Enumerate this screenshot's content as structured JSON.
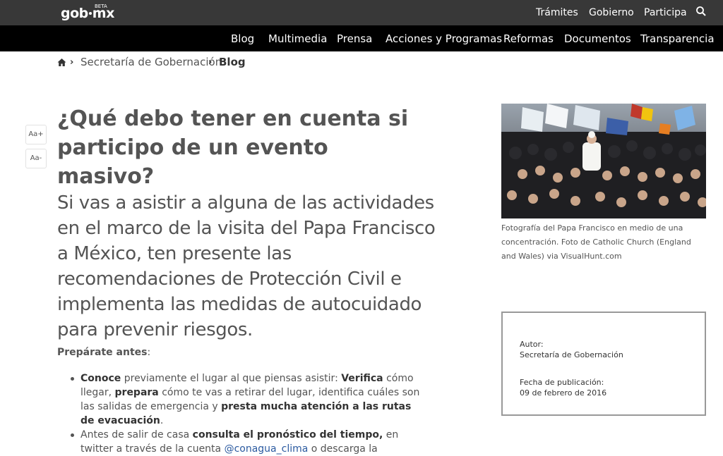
{
  "header": {
    "logo_prefix": "gob",
    "logo_suffix": "mx",
    "beta": "BETA",
    "top_links": [
      "Trámites",
      "Gobierno",
      "Participa"
    ],
    "search_icon": "search-icon"
  },
  "mainnav": {
    "items": [
      "Blog",
      "Multimedia",
      "Prensa",
      "Acciones y Programas",
      "Reformas",
      "Documentos",
      "Transparencia"
    ]
  },
  "breadcrumb": {
    "home_icon": "home-icon",
    "link": "Secretaría de Gobernación",
    "current": "Blog"
  },
  "font_controls": {
    "increase": "Aa+",
    "decrease": "Aa-"
  },
  "article": {
    "title": "¿Qué debo tener en cuenta si participo de un evento masivo?",
    "lead": "Si vas a asistir a alguna de las actividades en el marco de la visita del Papa Francisco a México, ten presente las recomendaciones de Protección Civil e implementa las medidas de autocuidado para prevenir riesgos.",
    "prep_bold": "Prepárate antes",
    "prep_colon": ":",
    "bullet1": {
      "b1": "Conoce",
      "t1": " previamente el lugar al que piensas asistir: ",
      "b2": "Verifica",
      "t2": " cómo llegar, ",
      "b3": "prepara",
      "t3": " cómo te vas a retirar del lugar, identifica cuáles son las salidas de emergencia y ",
      "b4": "presta mucha atención a las rutas de evacuación",
      "t4": "."
    },
    "bullet2": {
      "t1": "Antes de salir de casa ",
      "b1": "consulta el pronóstico del tiempo,",
      "t2": " en twitter a través de la cuenta ",
      "link": "@conagua_clima",
      "t3": " o descarga la aplicación MeteoInfo disponible para dispositivos iOS y Android."
    }
  },
  "sidebar": {
    "caption": "Fotografía del Papa Francisco en medio de una concentración. Foto de Catholic Church (England and Wales) via VisualHunt.com",
    "author_label": "Autor:",
    "author": "Secretaría de Gobernación",
    "date_label": "Fecha de publicación:",
    "date": "09 de febrero de 2016"
  },
  "colors": {
    "topbar": "#383838",
    "mainnav": "#000000",
    "text": "#545454",
    "link": "#2b5aa0"
  }
}
